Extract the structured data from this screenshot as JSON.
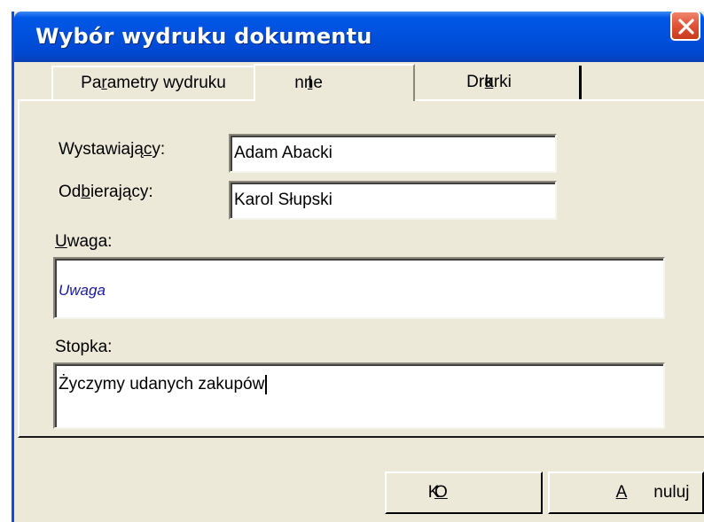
{
  "window": {
    "title": "Wybór wydruku dokumentu"
  },
  "tabs": [
    {
      "label_pre": "Pa",
      "label_mn": "r",
      "label_post": "ametry wydruku"
    },
    {
      "label_pre": "",
      "label_mn": "I",
      "label_post": "nne",
      "active": true
    },
    {
      "label_pre": "Dru",
      "label_mn": "k",
      "label_post": "arki"
    }
  ],
  "form": {
    "issuer": {
      "label_pre": "Wystawiają",
      "label_mn": "c",
      "label_post": "y:",
      "value": "Adam Abacki"
    },
    "receiver": {
      "label_pre": "Od",
      "label_mn": "b",
      "label_post": "ierający:",
      "value": "Karol Słupski"
    },
    "note": {
      "label_mn": "U",
      "label_post": "waga:",
      "value": "Uwaga"
    },
    "footer": {
      "label": "Stopka:",
      "value": "Życzymy udanych zakupów"
    }
  },
  "buttons": {
    "ok": {
      "label_mn": "O",
      "label_post": "K"
    },
    "cancel": {
      "label_mn": "A",
      "label_post": "nuluj"
    }
  },
  "colors": {
    "titlebar": "#0050dc",
    "dialog_bg": "#ece9d8",
    "close_button": "#e2553b",
    "note_text": "#1a1aa0"
  },
  "icons": {
    "close": "close-icon"
  }
}
